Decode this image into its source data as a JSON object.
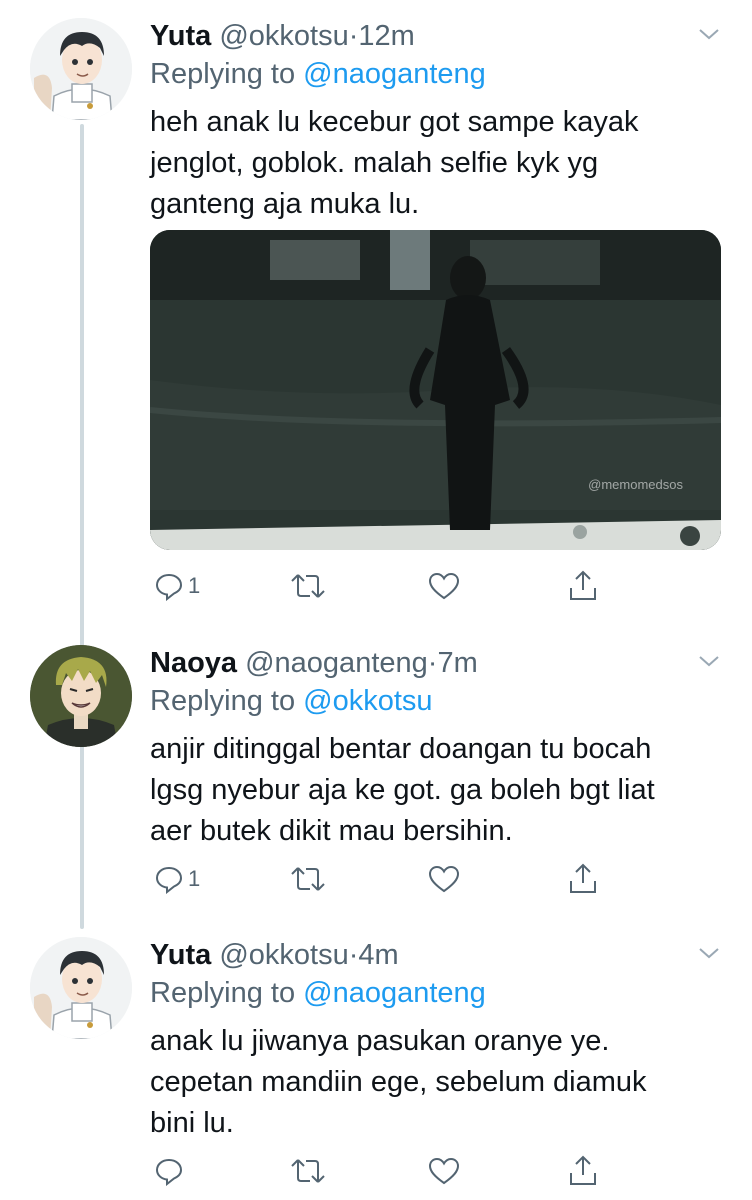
{
  "tweets": [
    {
      "name": "Yuta",
      "handle": "@okkotsu",
      "separator": "·",
      "time": "12m",
      "replying_prefix": "Replying to",
      "replying_to": "@naoganteng",
      "text_lines": [
        "heh anak lu kecebur got sampe kayak",
        "jenglot, goblok. malah selfie kyk yg",
        "ganteng aja muka lu."
      ],
      "media_watermark": "@memomedsos",
      "reply_count": "1",
      "avatar_icon": "anime-boy-white-uniform-avatar"
    },
    {
      "name": "Naoya",
      "handle": "@naoganteng",
      "separator": "·",
      "time": "7m",
      "replying_prefix": "Replying to",
      "replying_to": "@okkotsu",
      "text_lines": [
        "anjir ditinggal bentar doangan tu bocah",
        "lgsg nyebur aja ke got. ga boleh bgt liat",
        "aer butek dikit mau bersihin."
      ],
      "reply_count": "1",
      "avatar_icon": "anime-blond-man-avatar"
    },
    {
      "name": "Yuta",
      "handle": "@okkotsu",
      "separator": "·",
      "time": "4m",
      "replying_prefix": "Replying to",
      "replying_to": "@naoganteng",
      "text_lines": [
        "anak lu jiwanya pasukan oranye ye.",
        "cepetan mandiin ege, sebelum diamuk",
        "bini lu."
      ],
      "reply_count": "",
      "avatar_icon": "anime-boy-white-uniform-avatar"
    }
  ],
  "colors": {
    "link": "#1d9bf0",
    "secondary": "#536471",
    "thread_line": "#cfd9de"
  }
}
